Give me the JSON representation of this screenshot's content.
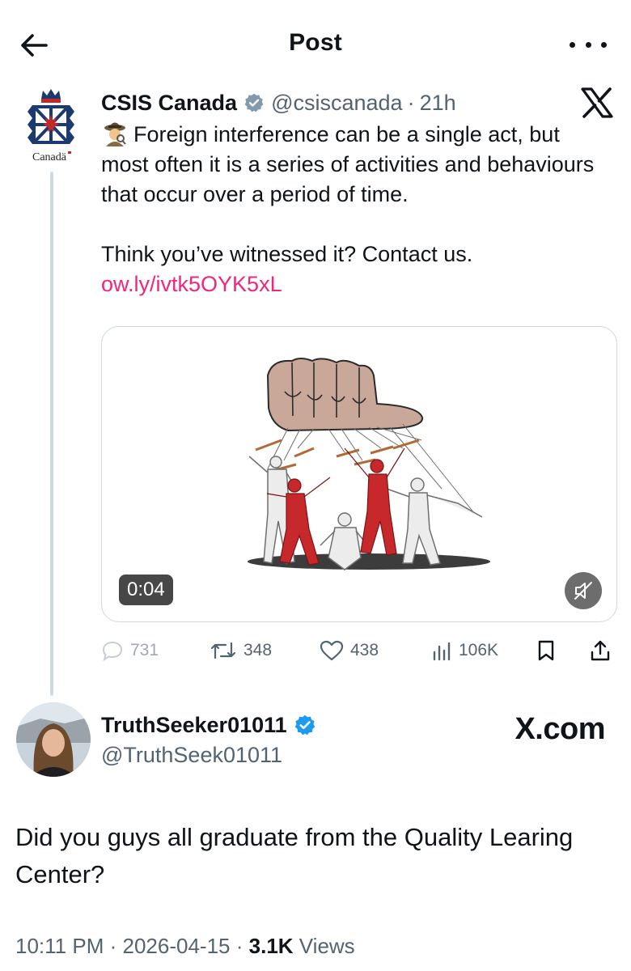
{
  "header": {
    "title": "Post"
  },
  "parent_post": {
    "author_name": "CSIS Canada",
    "author_handle": "@csiscanada",
    "separator": "·",
    "time": "21h",
    "avatar_wordmark": "Canadä",
    "text_line1": "Foreign interference can be a single act, but most often it is a series of activities and behaviours that occur over a period of time.",
    "text_line2": "Think you’ve witnessed it? Contact us.",
    "link": "ow.ly/ivtk5OYK5xL",
    "video_duration": "0:04",
    "stats": {
      "replies": "731",
      "reposts": "348",
      "likes": "438",
      "views": "106K"
    }
  },
  "reply_post": {
    "author_name": "TruthSeeker01011",
    "author_handle": "@TruthSeek01011",
    "watermark": "X.com",
    "text": "Did you guys all graduate from the Quality Learing Center?",
    "time": "10:11 PM",
    "date": "2026-04-15",
    "separator": "·",
    "views_count": "3.1K",
    "views_label": "Views"
  },
  "colors": {
    "text_primary": "#0f1419",
    "text_secondary": "#536471",
    "link": "#f0257e",
    "verified_blue": "#1d9bf0",
    "verified_gray": "#829aab",
    "border": "#cfd9de",
    "puppet_red": "#c6282b"
  },
  "icons": {
    "back": "arrow-left-icon",
    "more": "more-horizontal-icon",
    "brand": "x-logo-icon",
    "reply": "comment-icon",
    "repost": "repost-icon",
    "like": "heart-icon",
    "views": "analytics-icon",
    "bookmark": "bookmark-icon",
    "share": "share-icon",
    "mute": "muted-speaker-icon"
  }
}
